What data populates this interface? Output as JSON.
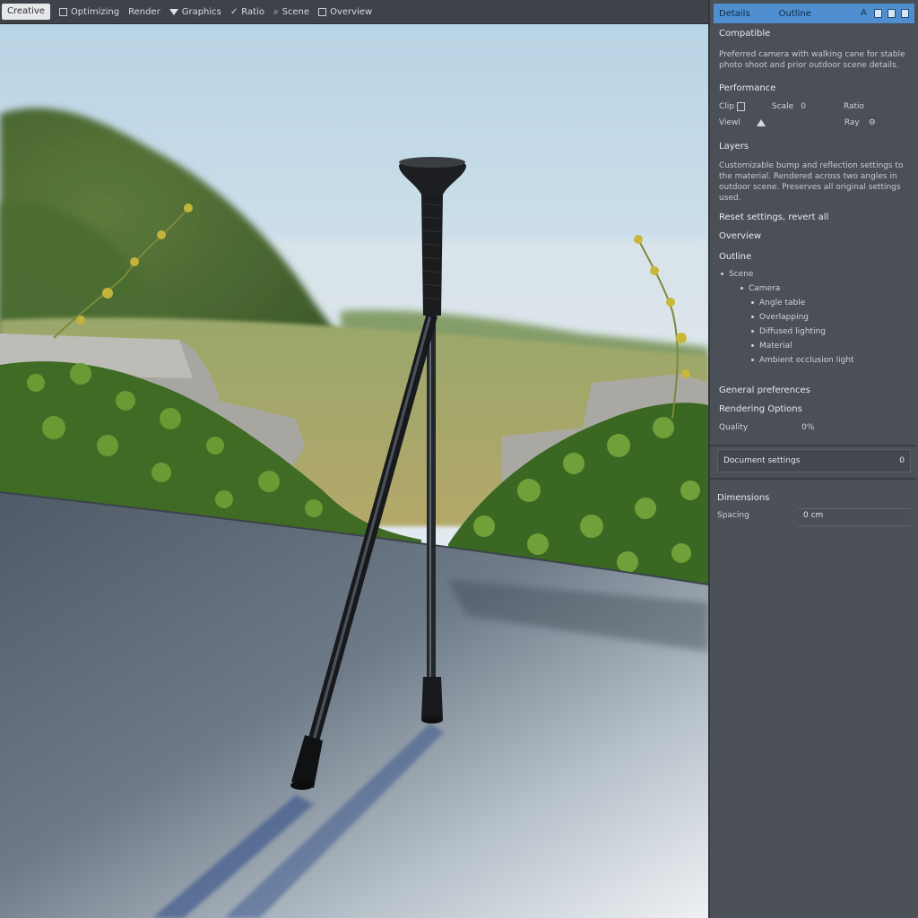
{
  "toolbar": {
    "active_tab": "Creative",
    "items": [
      {
        "label": "Optimizing"
      },
      {
        "label": "Render"
      },
      {
        "label": "Graphics"
      },
      {
        "label": "Ratio"
      },
      {
        "label": "Scene"
      },
      {
        "label": "Overview"
      }
    ]
  },
  "panel": {
    "header": {
      "tab1": "Details",
      "tab2": "Outline",
      "icon_a": "A"
    },
    "compatible": {
      "title": "Compatible",
      "text": "Preferred camera with walking cane for stable photo shoot and prior outdoor scene details.",
      "subtitle": "Performance"
    },
    "params": {
      "row1": {
        "label1": "Clip",
        "label2": "Scale",
        "value2": "0",
        "label3": "Ratio"
      },
      "row2": {
        "label1": "Viewl",
        "label2": "Ray"
      }
    },
    "layers": {
      "title": "Layers",
      "text": "Customizable bump and reflection settings to the material. Rendered across two angles in outdoor scene. Preserves all original settings used.",
      "link": "Reset settings, revert all"
    },
    "overview": {
      "title": "Overview"
    },
    "outline": {
      "title": "Outline",
      "root": "Scene",
      "child": "Camera",
      "leaves": [
        "Angle table",
        "Overlapping",
        "Diffused lighting",
        "Material",
        "Ambient occlusion light"
      ]
    },
    "general": {
      "title": "General preferences",
      "subtitle": "Rendering Options",
      "param_label": "Quality",
      "param_value": "0%"
    },
    "field": {
      "label": "Document settings",
      "value": "0"
    },
    "dimensions": {
      "title": "Dimensions",
      "label": "Spacing",
      "value": "0 cm"
    }
  },
  "colors": {
    "accent": "#4f8fd0",
    "panel_bg": "#4b4f56",
    "toolbar_bg": "#3f4349"
  }
}
